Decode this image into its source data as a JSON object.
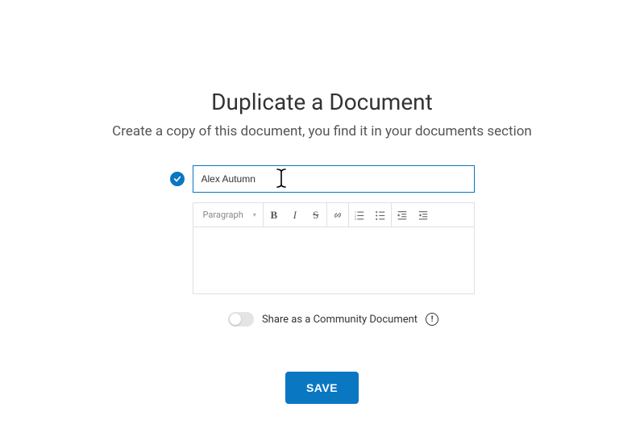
{
  "header": {
    "title": "Duplicate a Document",
    "subtitle": "Create a copy of this document, you find it in your documents section"
  },
  "form": {
    "title_value": "Alex Autumn",
    "format_dropdown_label": "Paragraph"
  },
  "share": {
    "label": "Share as a Community Document"
  },
  "actions": {
    "save_label": "Save"
  }
}
